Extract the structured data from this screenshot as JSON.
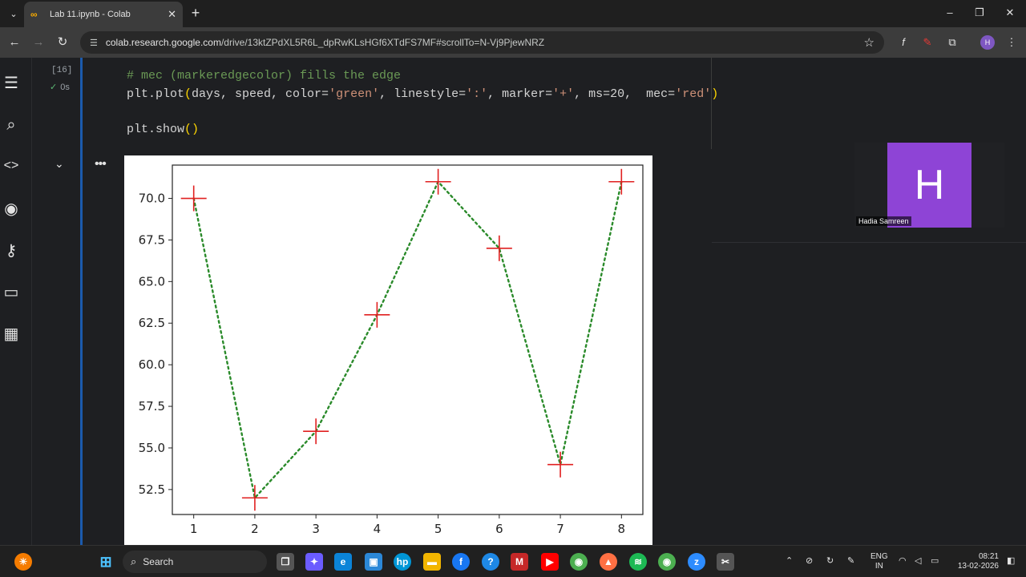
{
  "browser": {
    "tab_title": "Lab 11.ipynb - Colab",
    "url_host": "colab.research.google.com",
    "url_path": "/drive/13ktZPdXL5R6L_dpRwKLsHGf6XTdFS7MF#scrollTo=N-Vj9PjewNRZ"
  },
  "cell": {
    "exec_count": "[16]",
    "exec_time": "0s",
    "line1_comment": "# mec (markeredgecolor) fills the edge",
    "line2_a": "plt.plot",
    "line2_paren_open": "(",
    "line2_b": "days, speed, color=",
    "line2_s1": "'green'",
    "line2_c": ", linestyle=",
    "line2_s2": "':'",
    "line2_d": ", marker=",
    "line2_s3": "'+'",
    "line2_e": ", ms=20,  mec=",
    "line2_s4": "'red'",
    "line2_paren_close": ")",
    "line3": "plt.show",
    "line3_parens": "()"
  },
  "video": {
    "initial": "H",
    "name": "Hadia Samreen"
  },
  "taskbar": {
    "search_label": "Search",
    "lang_line1": "ENG",
    "lang_line2": "IN",
    "time": "08:21",
    "date": "13-02-2026"
  },
  "colors": {
    "line": "#2a8a2a",
    "marker": "#e02020"
  },
  "chart_data": {
    "type": "line",
    "x": [
      1,
      2,
      3,
      4,
      5,
      6,
      7,
      8
    ],
    "y": [
      70,
      52,
      56,
      63,
      71,
      67,
      54,
      71
    ],
    "xticks": [
      "1",
      "2",
      "3",
      "4",
      "5",
      "6",
      "7",
      "8"
    ],
    "yticks": [
      "52.5",
      "55.0",
      "57.5",
      "60.0",
      "62.5",
      "65.0",
      "67.5",
      "70.0"
    ],
    "ylim": [
      51,
      72
    ],
    "xlim": [
      0.65,
      8.35
    ],
    "linestyle": "dotted",
    "marker": "+",
    "title": "",
    "xlabel": "",
    "ylabel": ""
  }
}
